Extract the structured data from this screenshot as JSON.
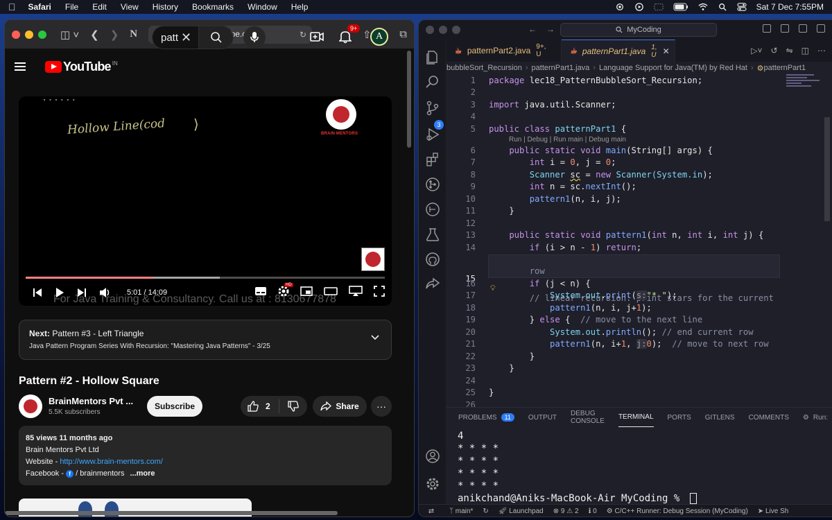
{
  "menubar": {
    "app": "Safari",
    "items": [
      "File",
      "Edit",
      "View",
      "History",
      "Bookmarks",
      "Window",
      "Help"
    ],
    "datetime": "Sat 7 Dec  7:55PM"
  },
  "safari": {
    "url": "youtube.com"
  },
  "youtube": {
    "logo_text": "YouTube",
    "region": "IN",
    "search_value": "patt",
    "notification_count": "9+",
    "avatar_letter": "A",
    "video": {
      "handwriting": "Hollow Line(cod",
      "brand": "BRAIN MENTORS",
      "current_time": "5:01",
      "duration": "14:09",
      "time_separator": " / ",
      "progress": 0.356,
      "buffered": 0.54,
      "watermark": "For Java Training & Consultancy. Call us at : 8130677878",
      "settings_badge": "HD"
    },
    "next": {
      "label": "Next:",
      "title": "Pattern #3 - Left Triangle",
      "playlist": "Java Pattern Program Series With Recursion: \"Mastering Java Patterns\" - 3/25"
    },
    "title": "Pattern #2 - Hollow Square",
    "channel": {
      "name": "BrainMentors Pvt ...",
      "subscribers": "5.5K subscribers",
      "subscribe_label": "Subscribe"
    },
    "actions": {
      "likes": "2",
      "share_label": "Share",
      "more_label": "···"
    },
    "description": {
      "views": "85 views  11 months ago",
      "line1": "Brain Mentors Pvt Ltd",
      "website_label": "Website - ",
      "website_url": "http://www.brain-mentors.com/",
      "facebook_label": "Facebook - ",
      "facebook_handle": " / brainmentors",
      "more": "...more"
    }
  },
  "vscode": {
    "search": "MyCoding",
    "tabs": [
      {
        "name": "patternPart2.java",
        "status": "9+, U"
      },
      {
        "name": "patternPart1.java",
        "status": "1, U"
      }
    ],
    "breadcrumb": [
      "bubbleSort_Recursion",
      "patternPart1.java",
      "Language Support for Java(TM) by Red Hat",
      "patternPart1"
    ],
    "codelens": "Run | Debug | Run main | Debug main",
    "line_numbers": [
      "1",
      "2",
      "3",
      "4",
      "5",
      "6",
      "7",
      "8",
      "9",
      "10",
      "11",
      "12",
      "13",
      "14",
      "15",
      "16",
      "17",
      "18",
      "19",
      "20",
      "21",
      "22",
      "23",
      "24",
      "25",
      "26"
    ],
    "code": {
      "l1_kw": "package",
      "l1_rest": " lec18_PatternBubbleSort_Recursion;",
      "l3_kw": "import",
      "l3_rest": " java.util.Scanner;",
      "l5_kw": "public class",
      "l5_ty": " patternPart1",
      "l5_rest": " {",
      "l6_kw": "    public static void",
      "l6_fn": " main",
      "l6_rest": "(String[] args) {",
      "l7_ty": "        int",
      "l7_rest": " i = ",
      "l7_n1": "0",
      "l7_mid": ", j = ",
      "l7_n2": "0",
      "l7_end": ";",
      "l8_a": "        Scanner ",
      "l8_sc": "sc",
      "l8_b": " = ",
      "l8_new": "new",
      "l8_c": " Scanner(System.",
      "l8_in": "in",
      "l8_d": ");",
      "l9_ty": "        int",
      "l9_rest": " n = sc.",
      "l9_fn": "nextInt",
      "l9_end": "();",
      "l10_fn": "        pattern1",
      "l10_rest": "(n, i, j);",
      "l11": "    }",
      "l13_kw": "    public static void",
      "l13_fn": " pattern1",
      "l13_a": "(",
      "l13_t1": "int",
      "l13_b": " n, ",
      "l13_t2": "int",
      "l13_c": " i, ",
      "l13_t3": "int",
      "l13_d": " j) {",
      "l14_kw": "        if",
      "l14_a": " (i > n - ",
      "l14_n": "1",
      "l14_b": ") ",
      "l14_ret": "return",
      "l14_c": ";",
      "l15_cm": "        // linear recursion: print stars for the current",
      "l15b_cm": "        row",
      "l16_kw": "        if",
      "l16_rest": " (j < n) {",
      "l17_a": "            System.",
      "l17_out": "out",
      "l17_b": ".",
      "l17_fn": "print",
      "l17_c": "(",
      "l17_hint": "s:",
      "l17_str": "\"* \"",
      "l17_d": ");",
      "l18_fn": "            pattern1",
      "l18_a": "(n, i, j+",
      "l18_n": "1",
      "l18_b": ");",
      "l19_a": "        } ",
      "l19_kw": "else",
      "l19_b": " {  ",
      "l19_cm": "// move to the next line",
      "l20_a": "            System.",
      "l20_out": "out",
      "l20_b": ".",
      "l20_fn": "println",
      "l20_c": "(); ",
      "l20_cm": "// end current row",
      "l21_fn": "            pattern1",
      "l21_a": "(n, i+",
      "l21_n": "1",
      "l21_b": ", ",
      "l21_hint": "j:",
      "l21_n2": "0",
      "l21_c": ");  ",
      "l21_cm": "// move to next row",
      "l22": "        }",
      "l23": "    }",
      "l25": "}"
    },
    "panel": {
      "tabs": [
        "PROBLEMS",
        "OUTPUT",
        "DEBUG CONSOLE",
        "TERMINAL",
        "PORTS",
        "GITLENS",
        "COMMENTS",
        "Run:"
      ],
      "problems_count": "11",
      "terminal_lines": [
        "4",
        "* * * *",
        "* * * *",
        "* * * *",
        "* * * *"
      ],
      "prompt": "anikchand@Aniks-MacBook-Air MyCoding % "
    },
    "status": {
      "branch": "main*",
      "launchpad": "Launchpad",
      "errors": "9",
      "warnings": "2",
      "info": "0",
      "runner": "C/C++ Runner: Debug Session (MyCoding)",
      "live": "Live Sh"
    }
  },
  "colors": {
    "youtube_red": "#ff0000",
    "vscode_accent": "#2f7ef5"
  }
}
